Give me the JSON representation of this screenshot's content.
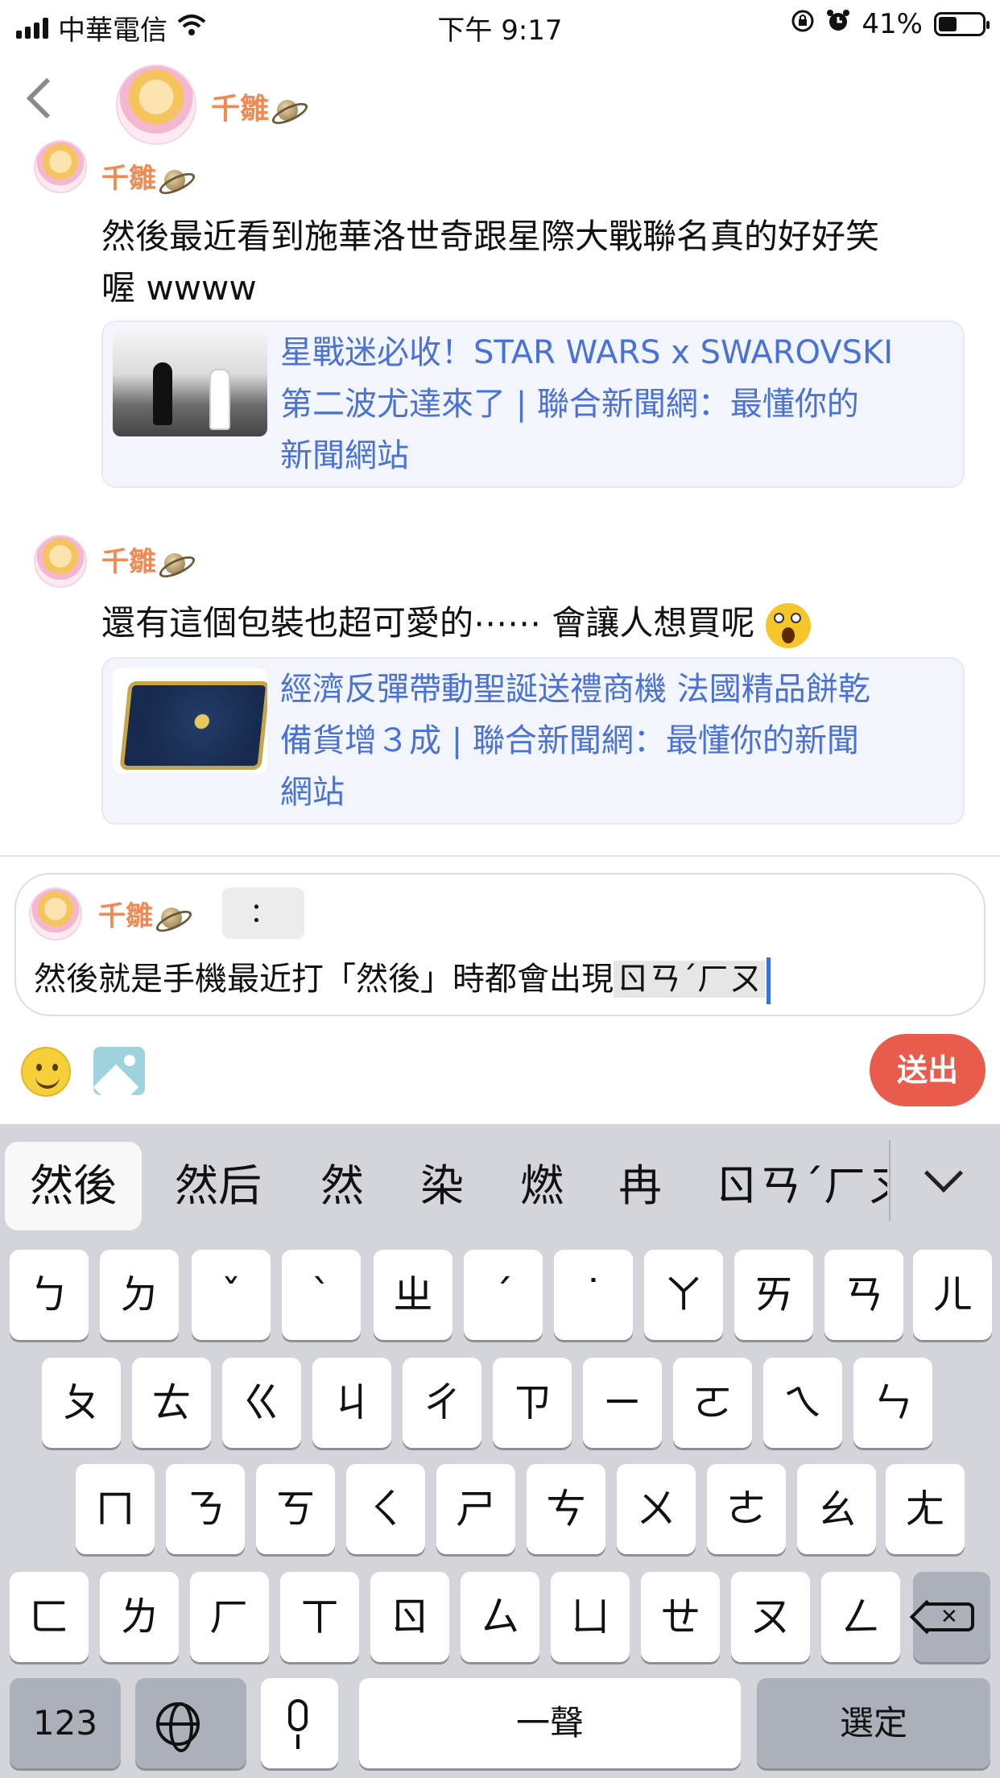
{
  "status_bar": {
    "carrier": "中華電信",
    "time": "下午 9:17",
    "battery": "41%",
    "icons": [
      "signal-icon",
      "wifi-icon",
      "orientation-lock-icon",
      "alarm-icon",
      "battery-icon"
    ]
  },
  "header": {
    "name": "千雛"
  },
  "messages": [
    {
      "name": "千雛",
      "text_line1": "然後最近看到施華洛世奇跟星際大戰聯名真的好好笑",
      "text_line2": "喔 wwww",
      "link": {
        "line1": "星戰迷必收！STAR WARS x SWAROVSKI",
        "line2": "第二波尤達來了 | 聯合新聞網：最懂你的",
        "line3": "新聞網站"
      }
    },
    {
      "name": "千雛",
      "text": "還有這個包裝也超可愛的⋯⋯ 會讓人想買呢",
      "link": {
        "line1": "經濟反彈帶動聖誕送禮商機 法國精品餅乾",
        "line2": "備貨增３成 | 聯合新聞網：最懂你的新聞",
        "line3": "網站"
      }
    }
  ],
  "composer": {
    "reply_name": "千雛",
    "colon": "：",
    "text": "然後就是手機最近打「然後」時都會出現",
    "marked_text": "ㄖㄢˊㄏㄡ"
  },
  "toolbar": {
    "send_label": "送出"
  },
  "keyboard": {
    "candidates": [
      "然後",
      "然后",
      "然",
      "染",
      "燃",
      "冉",
      "ㄖㄢˊㄏㄡ"
    ],
    "row1": [
      "ㄅ",
      "ㄉ",
      "ˇ",
      "ˋ",
      "ㄓ",
      "ˊ",
      "˙",
      "ㄚ",
      "ㄞ",
      "ㄢ",
      "ㄦ"
    ],
    "row2": [
      "ㄆ",
      "ㄊ",
      "ㄍ",
      "ㄐ",
      "ㄔ",
      "ㄗ",
      "ㄧ",
      "ㄛ",
      "ㄟ",
      "ㄣ"
    ],
    "row3": [
      "ㄇ",
      "ㄋ",
      "ㄎ",
      "ㄑ",
      "ㄕ",
      "ㄘ",
      "ㄨ",
      "ㄜ",
      "ㄠ",
      "ㄤ"
    ],
    "row4": [
      "ㄈ",
      "ㄌ",
      "ㄏ",
      "ㄒ",
      "ㄖ",
      "ㄙ",
      "ㄩ",
      "ㄝ",
      "ㄡ",
      "ㄥ"
    ],
    "numbers_label": "123",
    "space_label": "一聲",
    "confirm_label": "選定"
  }
}
